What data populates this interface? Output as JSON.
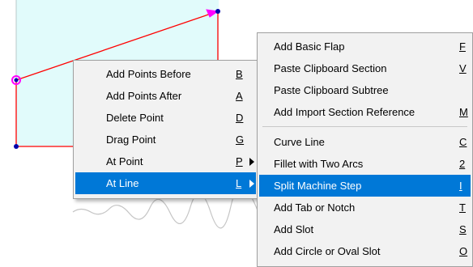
{
  "colors": {
    "shape_fill": "#e1fbfb",
    "shape_edge": "#ff0000",
    "point_color": "#0000aa",
    "highlight_point": "#ff00ff",
    "menu_bg": "#f2f2f2",
    "menu_selected_bg": "#0078d7",
    "menu_selected_text": "#ffffff"
  },
  "point_menu": {
    "items": [
      {
        "label": "Add Points Before",
        "shortcut": "B",
        "selected": false,
        "submenu": false
      },
      {
        "label": "Add Points After",
        "shortcut": "A",
        "selected": false,
        "submenu": false
      },
      {
        "label": "Delete Point",
        "shortcut": "D",
        "selected": false,
        "submenu": false
      },
      {
        "label": "Drag Point",
        "shortcut": "G",
        "selected": false,
        "submenu": false
      },
      {
        "label": "At Point",
        "shortcut": "P",
        "selected": false,
        "submenu": true
      },
      {
        "label": "At Line",
        "shortcut": "L",
        "selected": true,
        "submenu": true
      }
    ]
  },
  "line_menu": {
    "group1": [
      {
        "label": "Add Basic Flap",
        "shortcut": "F",
        "selected": false
      },
      {
        "label": "Paste Clipboard Section",
        "shortcut": "V",
        "selected": false
      },
      {
        "label": "Paste Clipboard Subtree",
        "shortcut": "",
        "selected": false
      },
      {
        "label": "Add Import Section Reference",
        "shortcut": "M",
        "selected": false
      }
    ],
    "group2": [
      {
        "label": "Curve Line",
        "shortcut": "C",
        "selected": false
      },
      {
        "label": "Fillet with Two Arcs",
        "shortcut": "2",
        "selected": false
      },
      {
        "label": "Split Machine Step",
        "shortcut": "I",
        "selected": true
      },
      {
        "label": "Add Tab or Notch",
        "shortcut": "T",
        "selected": false
      },
      {
        "label": "Add Slot",
        "shortcut": "S",
        "selected": false
      },
      {
        "label": "Add Circle or Oval Slot",
        "shortcut": "O",
        "selected": false
      }
    ]
  }
}
